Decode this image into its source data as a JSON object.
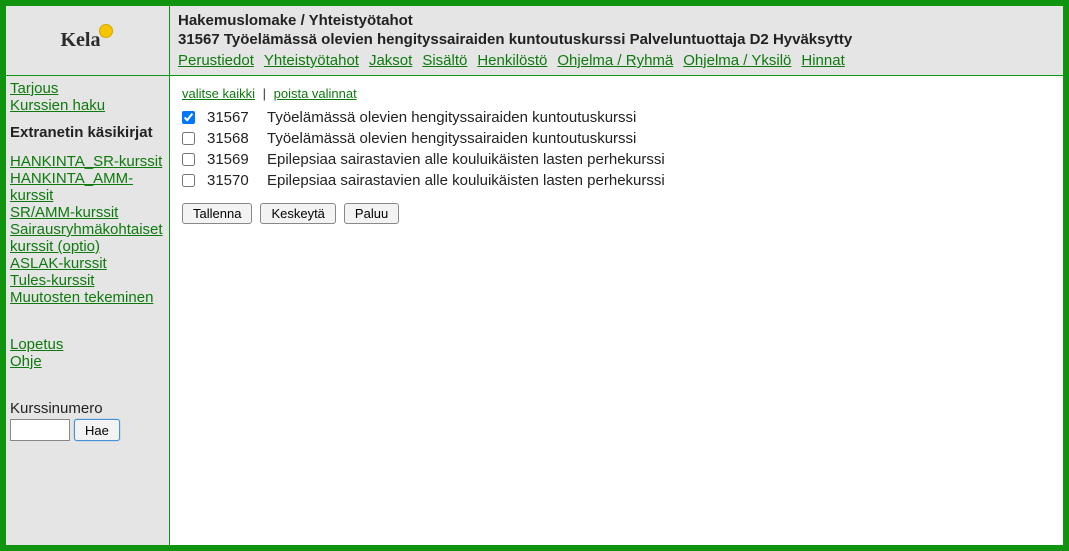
{
  "header": {
    "logo_text": "Kela",
    "breadcrumb": "Hakemuslomake / Yhteistyötahot",
    "title": "31567 Työelämässä olevien hengityssairaiden kuntoutuskurssi Palveluntuottaja D2 Hyväksytty",
    "tabs": [
      "Perustiedot",
      "Yhteistyötahot",
      "Jaksot",
      "Sisältö",
      "Henkilöstö",
      "Ohjelma / Ryhmä",
      "Ohjelma / Yksilö",
      "Hinnat"
    ]
  },
  "sidebar": {
    "top_links": [
      "Tarjous",
      "Kurssien haku"
    ],
    "heading": "Extranetin käsikirjat",
    "manual_links": [
      "HANKINTA_SR-kurssit",
      "HANKINTA_AMM-kurssit",
      "SR/AMM-kurssit",
      "Sairausryhmäkohtaiset kurssit (optio)",
      "ASLAK-kurssit",
      "Tules-kurssit",
      "Muutosten tekeminen"
    ],
    "bottom_links": [
      "Lopetus",
      "Ohje"
    ],
    "search_label": "Kurssinumero",
    "search_value": "",
    "search_button": "Hae"
  },
  "main": {
    "select_all": "valitse kaikki",
    "clear_all": "poista valinnat",
    "courses": [
      {
        "checked": true,
        "code": "31567",
        "desc": "Työelämässä olevien hengityssairaiden kuntoutuskurssi"
      },
      {
        "checked": false,
        "code": "31568",
        "desc": "Työelämässä olevien hengityssairaiden kuntoutuskurssi"
      },
      {
        "checked": false,
        "code": "31569",
        "desc": "Epilepsiaa sairastavien alle kouluikäisten lasten perhekurssi"
      },
      {
        "checked": false,
        "code": "31570",
        "desc": "Epilepsiaa sairastavien alle kouluikäisten lasten perhekurssi"
      }
    ],
    "buttons": {
      "save": "Tallenna",
      "cancel": "Keskeytä",
      "back": "Paluu"
    }
  }
}
